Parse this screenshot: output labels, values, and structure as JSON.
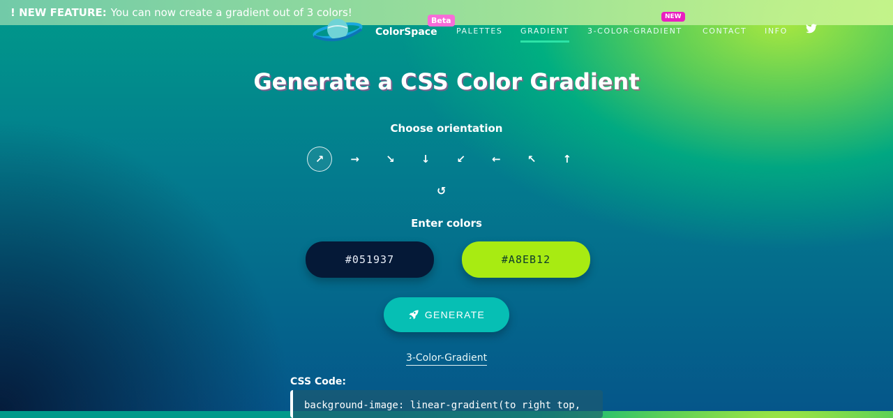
{
  "banner": {
    "bold": "! NEW FEATURE:",
    "text": "You can now create a gradient out of 3 colors!"
  },
  "brand": {
    "name": "ColorSpace",
    "beta_badge": "Beta"
  },
  "nav": {
    "items": [
      {
        "label": "PALETTES"
      },
      {
        "label": "GRADIENT"
      },
      {
        "label": "3-COLOR-GRADIENT"
      },
      {
        "label": "CONTACT"
      },
      {
        "label": "INFO"
      }
    ],
    "new_badge": "NEW",
    "active": "GRADIENT"
  },
  "page": {
    "title": "Generate a CSS Color Gradient",
    "orientation_label": "Choose orientation",
    "orientations": [
      "↗",
      "→",
      "↘",
      "↓",
      "↙",
      "←",
      "↖",
      "↑"
    ],
    "orientation_names": [
      "to-right-top",
      "to-right",
      "to-right-bottom",
      "to-bottom",
      "to-left-bottom",
      "to-left",
      "to-left-top",
      "to-top"
    ],
    "refresh_glyph": "↺",
    "colors_label": "Enter colors",
    "color1": "#051937",
    "color2": "#A8EB12",
    "generate_label": "GENERATE",
    "three_color_link": "3-Color-Gradient",
    "css_code_label": "CSS Code:",
    "css_code": "background-image: linear-gradient(to right top,"
  },
  "colors": {
    "accent": "#06bfb4",
    "badge_beta": "#f86cd8",
    "badge_new": "#e91ec0",
    "nav_active": "#2de3a7"
  }
}
